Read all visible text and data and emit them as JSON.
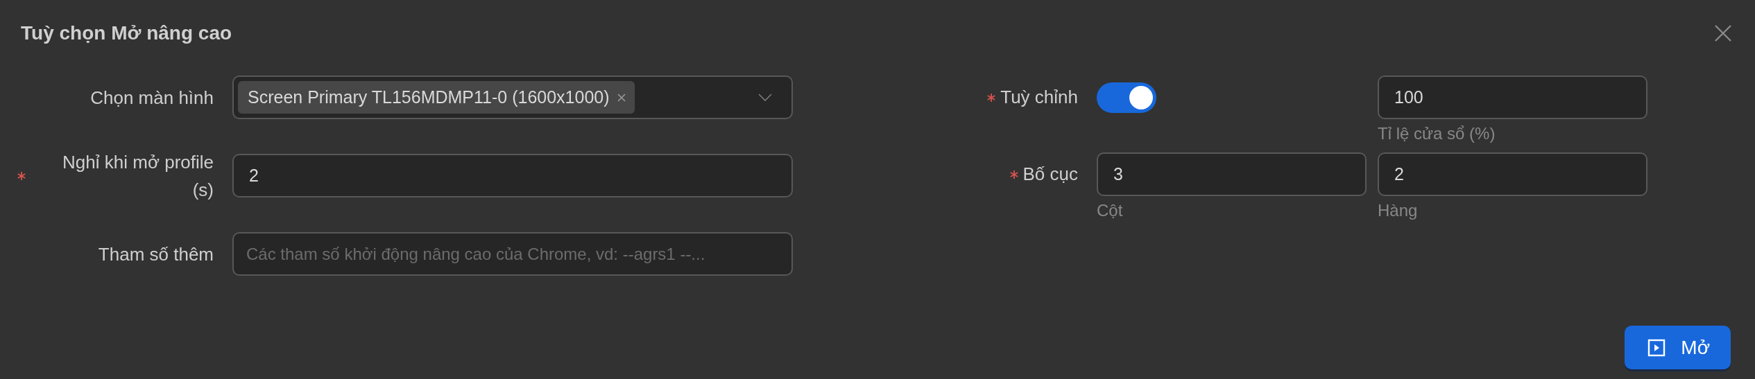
{
  "dialog": {
    "title": "Tuỳ chọn Mở nâng cao"
  },
  "left_fields": [
    {
      "kind": "select",
      "label": "Chọn màn hình",
      "required": false,
      "tags": [
        {
          "text": "Screen Primary TL156MDMP11-0 (1600x1000)"
        }
      ]
    },
    {
      "kind": "input",
      "label": "Nghỉ khi mở profile (s)",
      "required": true,
      "value": "2"
    },
    {
      "kind": "input",
      "label": "Tham số thêm",
      "required": false,
      "placeholder": "Các tham số khởi động nâng cao của Chrome, vd: --agrs1 --..."
    }
  ],
  "right_fields": [
    {
      "kind": "toggle",
      "label": "Tuỳ chỉnh",
      "required": true,
      "on": true,
      "inputs": [
        {
          "value": "100",
          "caption": "Tỉ lệ cửa sổ (%)"
        }
      ]
    },
    {
      "kind": "inputs",
      "label": "Bố cục",
      "required": true,
      "inputs": [
        {
          "value": "3",
          "caption": "Cột"
        },
        {
          "value": "2",
          "caption": "Hàng"
        }
      ]
    }
  ],
  "buttons": [
    {
      "label": "Mở",
      "kind": "primary"
    }
  ]
}
